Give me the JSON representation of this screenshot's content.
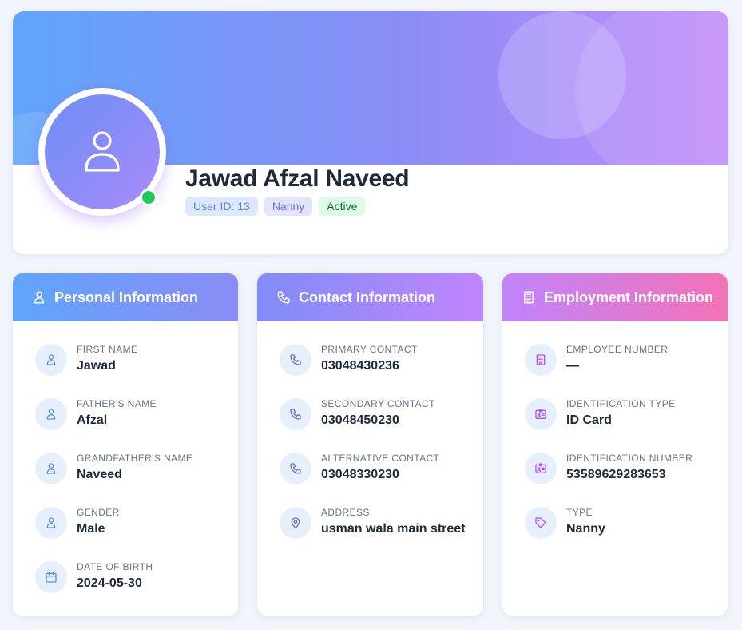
{
  "profile": {
    "name": "Jawad Afzal Naveed",
    "badges": {
      "user_id": "User ID: 13",
      "role": "Nanny",
      "status": "Active"
    },
    "status_color": "#22c55e"
  },
  "personal": {
    "title": "Personal Information",
    "fields": [
      {
        "label": "FIRST NAME",
        "value": "Jawad",
        "icon": "user-icon"
      },
      {
        "label": "FATHER'S NAME",
        "value": "Afzal",
        "icon": "user-icon"
      },
      {
        "label": "GRANDFATHER'S NAME",
        "value": "Naveed",
        "icon": "user-icon"
      },
      {
        "label": "GENDER",
        "value": "Male",
        "icon": "user-icon"
      },
      {
        "label": "DATE OF BIRTH",
        "value": "2024-05-30",
        "icon": "calendar-icon"
      }
    ]
  },
  "contact": {
    "title": "Contact Information",
    "fields": [
      {
        "label": "PRIMARY CONTACT",
        "value": "03048430236",
        "icon": "phone-icon"
      },
      {
        "label": "SECONDARY CONTACT",
        "value": "03048450230",
        "icon": "phone-icon"
      },
      {
        "label": "ALTERNATIVE CONTACT",
        "value": "03048330230",
        "icon": "phone-icon"
      },
      {
        "label": "ADDRESS",
        "value": "usman wala main street",
        "icon": "map-pin-icon"
      }
    ]
  },
  "employment": {
    "title": "Employment Information",
    "fields": [
      {
        "label": "EMPLOYEE NUMBER",
        "value": "—",
        "icon": "building-icon"
      },
      {
        "label": "IDENTIFICATION TYPE",
        "value": "ID Card",
        "icon": "id-card-icon"
      },
      {
        "label": "IDENTIFICATION NUMBER",
        "value": "53589629283653",
        "icon": "id-card-icon"
      },
      {
        "label": "TYPE",
        "value": "Nanny",
        "icon": "tag-icon"
      }
    ]
  }
}
